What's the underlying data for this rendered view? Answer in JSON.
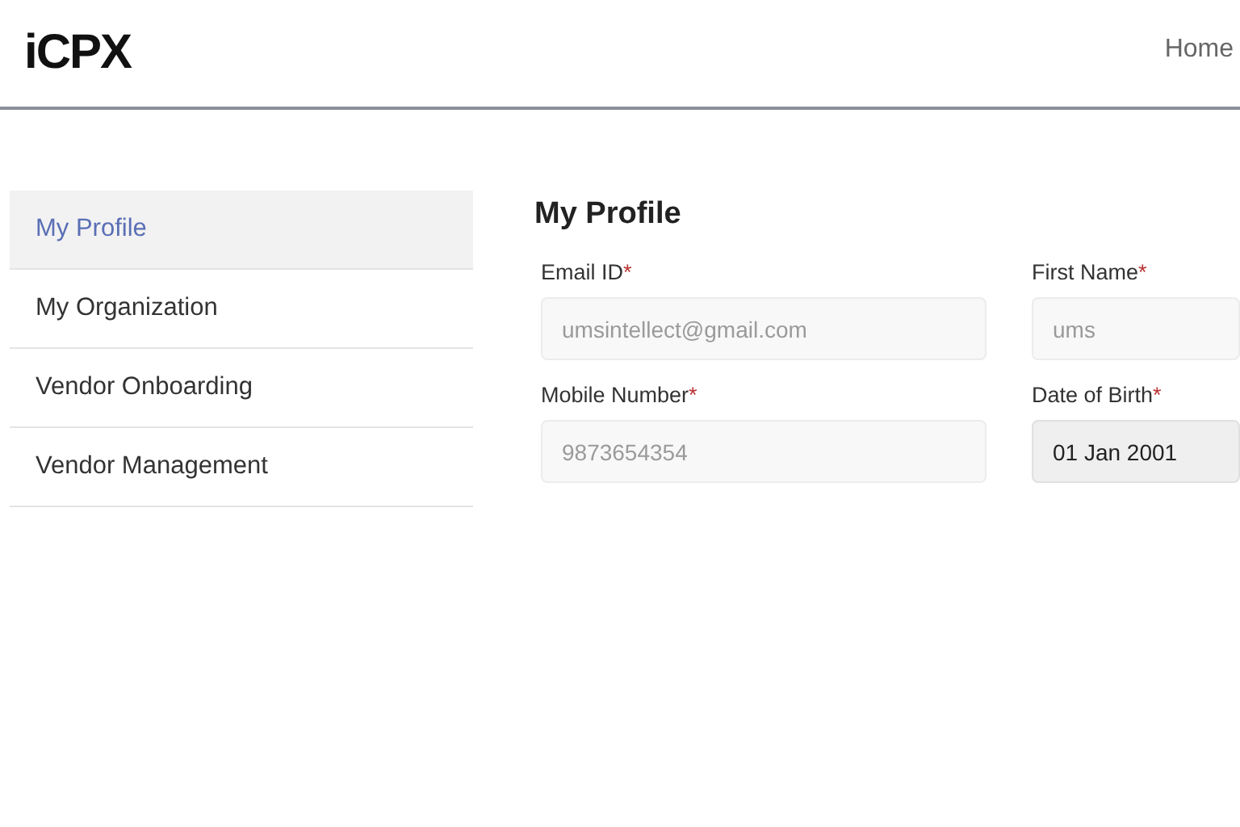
{
  "header": {
    "logo": "iCPX",
    "nav": [
      {
        "label": "Home"
      }
    ]
  },
  "sidebar": {
    "items": [
      {
        "label": "My Profile",
        "selected": true
      },
      {
        "label": "My Organization",
        "selected": false
      },
      {
        "label": "Vendor Onboarding",
        "selected": false
      },
      {
        "label": "Vendor Management",
        "selected": false
      }
    ]
  },
  "profile": {
    "title": "My Profile",
    "fields": [
      {
        "label": "Email ID",
        "required_mark": "*",
        "value": "umsintellect@gmail.com",
        "disabled": true
      },
      {
        "label": "First Name",
        "required_mark": "*",
        "value": "ums",
        "disabled": true
      },
      {
        "label": "Mobile Number",
        "required_mark": "*",
        "value": "9873654354",
        "disabled": true
      },
      {
        "label": "Date of Birth",
        "required_mark": "*",
        "value": "01 Jan 2001",
        "disabled": false
      }
    ]
  }
}
